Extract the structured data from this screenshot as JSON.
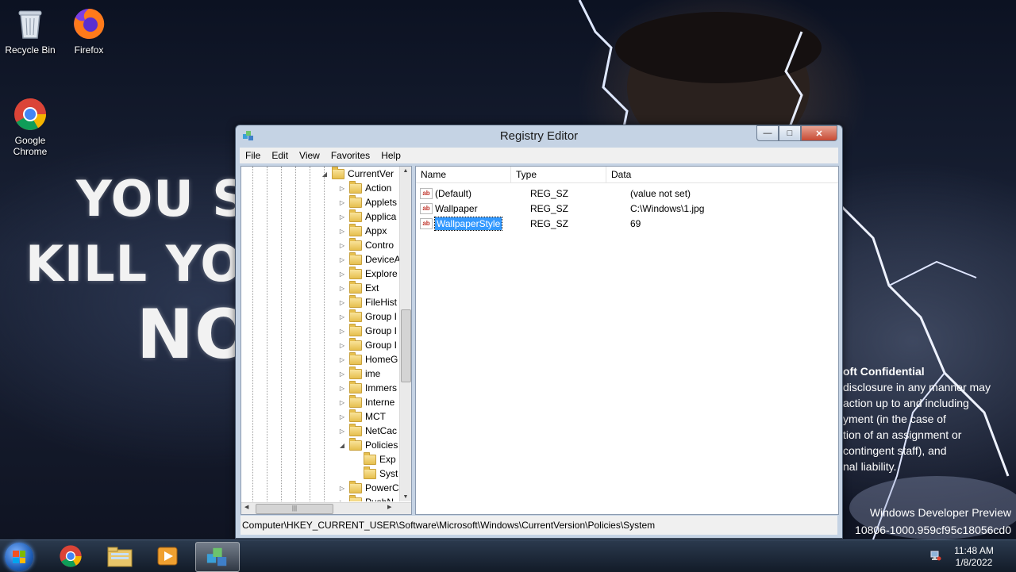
{
  "desktop": {
    "icons": [
      {
        "label": "Recycle Bin"
      },
      {
        "label": "Firefox"
      },
      {
        "label": "Google Chrome"
      }
    ],
    "wallpaper_text": [
      "YOU S",
      "KILL YO",
      "NO"
    ],
    "confidential": {
      "heading": "oft Confidential",
      "body": "disclosure in any manner may\naction up to and including\nyment (in the case of\ntion of an assignment or\ncontingent staff), and\nnal liability."
    },
    "watermark": {
      "line1": "Windows Developer Preview",
      "line2": "10806-1000.959cf95c18056cd0"
    }
  },
  "window": {
    "title": "Registry Editor",
    "menu": [
      "File",
      "Edit",
      "View",
      "Favorites",
      "Help"
    ],
    "tree": {
      "root": "CurrentVer",
      "items": [
        "Action",
        "Applets",
        "Applica",
        "Appx",
        "Contro",
        "DeviceA",
        "Explore",
        "Ext",
        "FileHist",
        "Group I",
        "Group I",
        "Group I",
        "HomeG",
        "ime",
        "Immers",
        "Interne",
        "MCT",
        "NetCac",
        "Policies"
      ],
      "policies_children": [
        "Exp",
        "Syst"
      ],
      "after": [
        "PowerC",
        "PushN"
      ]
    },
    "columns": {
      "name": "Name",
      "type": "Type",
      "data": "Data"
    },
    "values": [
      {
        "name": "(Default)",
        "type": "REG_SZ",
        "data": "(value not set)"
      },
      {
        "name": "Wallpaper",
        "type": "REG_SZ",
        "data": "C:\\Windows\\1.jpg"
      },
      {
        "name": "WallpaperStyle",
        "type": "REG_SZ",
        "data": "69"
      }
    ],
    "status": "Computer\\HKEY_CURRENT_USER\\Software\\Microsoft\\Windows\\CurrentVersion\\Policies\\System"
  },
  "taskbar": {
    "clock_time": "11:48 AM",
    "clock_date": "1/8/2022"
  }
}
